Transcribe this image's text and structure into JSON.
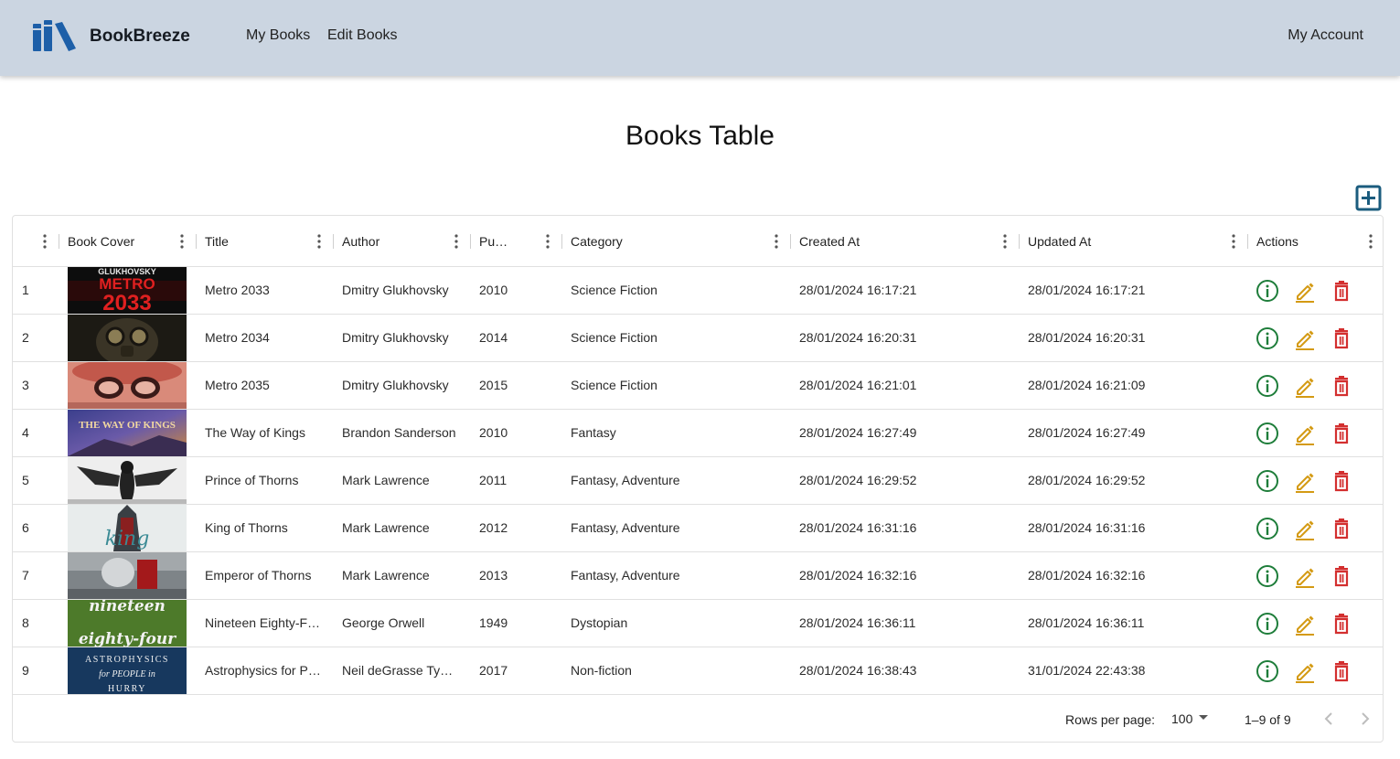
{
  "app": {
    "brand": "BookBreeze",
    "nav": {
      "my_books": "My Books",
      "edit_books": "Edit Books",
      "my_account": "My Account"
    }
  },
  "page": {
    "title": "Books Table"
  },
  "colors": {
    "header_bg": "#cbd5e1",
    "brand_blue": "#1d5fa8",
    "add_icon": "#1b5c7e",
    "info_icon": "#1e7d3a",
    "edit_icon": "#d49a13",
    "delete_icon": "#d32f2f"
  },
  "table": {
    "columns": [
      "",
      "Book Cover",
      "Title",
      "Author",
      "Pu…",
      "Category",
      "Created At",
      "Updated At",
      "Actions"
    ],
    "rows": [
      {
        "id": "1",
        "cover": "metro-2033-cover",
        "title": "Metro 2033",
        "author": "Dmitry Glukhovsky",
        "published": "2010",
        "category": "Science Fiction",
        "created": "28/01/2024 16:17:21",
        "updated": "28/01/2024 16:17:21"
      },
      {
        "id": "2",
        "cover": "metro-2034-cover",
        "title": "Metro 2034",
        "author": "Dmitry Glukhovsky",
        "published": "2014",
        "category": "Science Fiction",
        "created": "28/01/2024 16:20:31",
        "updated": "28/01/2024 16:20:31"
      },
      {
        "id": "3",
        "cover": "metro-2035-cover",
        "title": "Metro 2035",
        "author": "Dmitry Glukhovsky",
        "published": "2015",
        "category": "Science Fiction",
        "created": "28/01/2024 16:21:01",
        "updated": "28/01/2024 16:21:09"
      },
      {
        "id": "4",
        "cover": "way-of-kings-cover",
        "title": "The Way of Kings",
        "author": "Brandon Sanderson",
        "published": "2010",
        "category": "Fantasy",
        "created": "28/01/2024 16:27:49",
        "updated": "28/01/2024 16:27:49"
      },
      {
        "id": "5",
        "cover": "prince-of-thorns-cover",
        "title": "Prince of Thorns",
        "author": "Mark Lawrence",
        "published": "2011",
        "category": "Fantasy, Adventure",
        "created": "28/01/2024 16:29:52",
        "updated": "28/01/2024 16:29:52"
      },
      {
        "id": "6",
        "cover": "king-of-thorns-cover",
        "title": "King of Thorns",
        "author": "Mark Lawrence",
        "published": "2012",
        "category": "Fantasy, Adventure",
        "created": "28/01/2024 16:31:16",
        "updated": "28/01/2024 16:31:16"
      },
      {
        "id": "7",
        "cover": "emperor-of-thorns-cover",
        "title": "Emperor of Thorns",
        "author": "Mark Lawrence",
        "published": "2013",
        "category": "Fantasy, Adventure",
        "created": "28/01/2024 16:32:16",
        "updated": "28/01/2024 16:32:16"
      },
      {
        "id": "8",
        "cover": "nineteen-eighty-four-cover",
        "title": "Nineteen Eighty-F…",
        "author": "George Orwell",
        "published": "1949",
        "category": "Dystopian",
        "created": "28/01/2024 16:36:11",
        "updated": "28/01/2024 16:36:11"
      },
      {
        "id": "9",
        "cover": "astrophysics-cover",
        "title": "Astrophysics for P…",
        "author": "Neil deGrasse Ty…",
        "published": "2017",
        "category": "Non-fiction",
        "created": "28/01/2024 16:38:43",
        "updated": "31/01/2024 22:43:38"
      }
    ]
  },
  "covers": {
    "metro2033": {
      "top": "GLUKHOVSKY",
      "line1": "METRO",
      "line2": "2033"
    },
    "way_of_kings": "THE WAY OF KINGS",
    "king_of_thorns": "king",
    "nineteen_eighty_four": {
      "line1": "nineteen",
      "line2": "eighty-four"
    },
    "astrophysics": {
      "line1": "ASTROPHYSICS",
      "line2": "for PEOPLE in",
      "line3": "HURRY"
    }
  },
  "pagination": {
    "rows_per_page_label": "Rows per page:",
    "rows_per_page_value": "100",
    "range": "1–9 of 9"
  }
}
